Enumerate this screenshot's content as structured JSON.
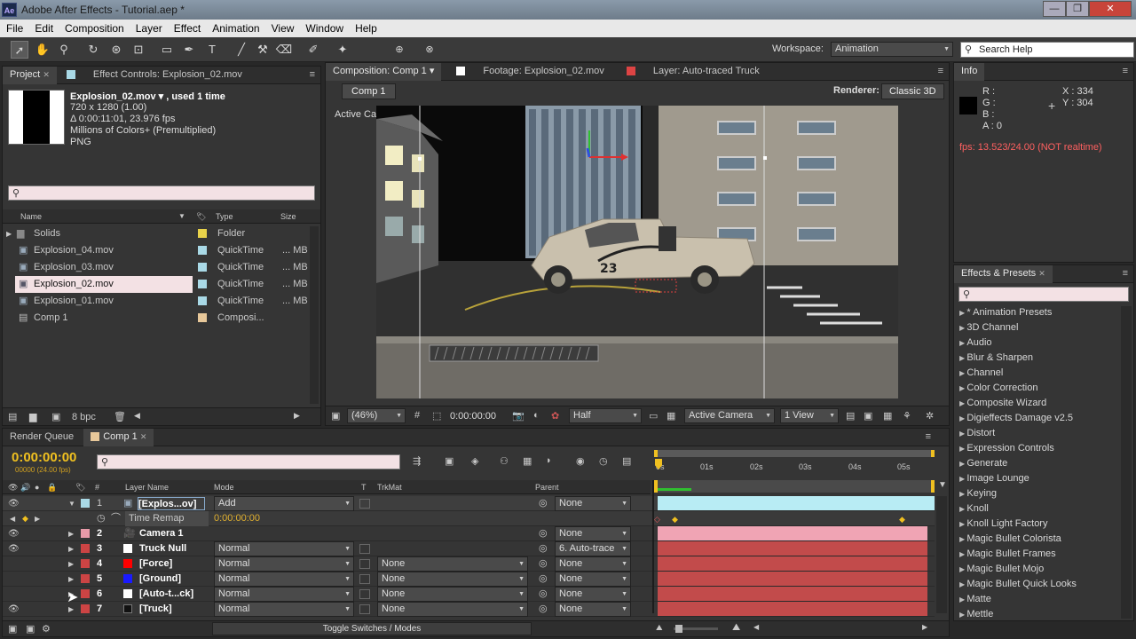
{
  "window": {
    "app_badge": "Ae",
    "title": "Adobe After Effects - Tutorial.aep *",
    "buttons": [
      "—",
      "❐",
      "✕"
    ]
  },
  "menu": [
    "File",
    "Edit",
    "Composition",
    "Layer",
    "Effect",
    "Animation",
    "View",
    "Window",
    "Help"
  ],
  "toolbar": {
    "workspace_label": "Workspace:",
    "workspace_value": "Animation",
    "search_placeholder": "Search Help"
  },
  "project": {
    "tab_project": "Project",
    "tab_effect_controls": "Effect Controls: Explosion_02.mov",
    "selected_name": "Explosion_02.mov ▾ , used 1 time",
    "info_lines": [
      "720 x 1280 (1.00)",
      "Δ 0:00:11:01, 23.976 fps",
      "Millions of Colors+ (Premultiplied)",
      "PNG"
    ],
    "search_value": "",
    "columns": {
      "name": "Name",
      "type": "Type",
      "size": "Size"
    },
    "items": [
      {
        "name": "Solids",
        "type": "Folder",
        "size": "",
        "color": "#e8d24a",
        "icon": "folder-icon"
      },
      {
        "name": "Explosion_04.mov",
        "type": "QuickTime",
        "size": "... MB",
        "color": "#a9d9e6",
        "icon": "footage-icon"
      },
      {
        "name": "Explosion_03.mov",
        "type": "QuickTime",
        "size": "... MB",
        "color": "#a9d9e6",
        "icon": "footage-icon"
      },
      {
        "name": "Explosion_02.mov",
        "type": "QuickTime",
        "size": "... MB",
        "color": "#a9d9e6",
        "icon": "footage-icon",
        "selected": true
      },
      {
        "name": "Explosion_01.mov",
        "type": "QuickTime",
        "size": "... MB",
        "color": "#a9d9e6",
        "icon": "footage-icon"
      },
      {
        "name": "Comp 1",
        "type": "Composi...",
        "size": "",
        "color": "#e8c89a",
        "icon": "composition-icon"
      }
    ],
    "bpc": "8 bpc"
  },
  "composition": {
    "tab_comp": "Composition: Comp 1",
    "tab_footage": "Footage: Explosion_02.mov",
    "tab_layer": "Layer: Auto-traced Truck",
    "breadcrumb": "Comp 1",
    "renderer_label": "Renderer:",
    "renderer_value": "Classic 3D",
    "view_label": "Active Camera",
    "truck_number": "23",
    "footer": {
      "zoom": "(46%)",
      "timecode": "0:00:00:00",
      "resolution": "Half",
      "camera": "Active Camera",
      "views": "1 View"
    }
  },
  "info": {
    "tab": "Info",
    "r": "R :",
    "g": "G :",
    "b": "B :",
    "a": "A : 0",
    "x": "X : 334",
    "y": "Y : 304",
    "fps": "fps: 13.523/24.00 (NOT realtime)"
  },
  "effects": {
    "tab": "Effects & Presets",
    "search_value": "",
    "items": [
      "* Animation Presets",
      "3D Channel",
      "Audio",
      "Blur & Sharpen",
      "Channel",
      "Color Correction",
      "Composite Wizard",
      "Digieffects Damage v2.5",
      "Distort",
      "Expression Controls",
      "Generate",
      "Image Lounge",
      "Keying",
      "Knoll",
      "Knoll Light Factory",
      "Magic Bullet Colorista",
      "Magic Bullet Frames",
      "Magic Bullet Mojo",
      "Magic Bullet Quick Looks",
      "Matte",
      "Mettle"
    ]
  },
  "timeline": {
    "tab_render": "Render Queue",
    "tab_comp": "Comp 1",
    "timecode": "0:00:00:00",
    "frames": "00000 (24.00 fps)",
    "search_value": "",
    "columns": {
      "num": "#",
      "name": "Layer Name",
      "mode": "Mode",
      "t": "T",
      "trkmat": "TrkMat",
      "parent": "Parent"
    },
    "ruler": [
      "0s",
      "01s",
      "02s",
      "03s",
      "04s",
      "05s"
    ],
    "toggle": "Toggle Switches / Modes",
    "sub_property": {
      "name": "Time Remap",
      "value": "0:00:00:00"
    },
    "layers": [
      {
        "num": "1",
        "name": "[Explos...ov]",
        "mode": "Add",
        "trkmat": "",
        "parent": "None",
        "label": "#a9d9e6",
        "swatch": "#ffffff",
        "bar": "#b8ecf4",
        "selected": true
      },
      {
        "num": "2",
        "name": "Camera 1",
        "mode": "",
        "trkmat": "",
        "parent": "None",
        "label": "#e89aa8",
        "swatch": "",
        "bar": "#f0a4b4"
      },
      {
        "num": "3",
        "name": "Truck Null",
        "mode": "Normal",
        "trkmat": "",
        "parent": "6. Auto-trace",
        "label": "#cc4444",
        "swatch": "#ffffff",
        "bar": "#c24b4b"
      },
      {
        "num": "4",
        "name": "[Force]",
        "mode": "Normal",
        "trkmat": "None",
        "parent": "None",
        "label": "#cc4444",
        "swatch": "#ff0000",
        "bar": "#c24b4b"
      },
      {
        "num": "5",
        "name": "[Ground]",
        "mode": "Normal",
        "trkmat": "None",
        "parent": "None",
        "label": "#cc4444",
        "swatch": "#1a1aff",
        "bar": "#c24b4b"
      },
      {
        "num": "6",
        "name": "[Auto-t...ck]",
        "mode": "Normal",
        "trkmat": "None",
        "parent": "None",
        "label": "#cc4444",
        "swatch": "#ffffff",
        "bar": "#c24b4b"
      },
      {
        "num": "7",
        "name": "[Truck]",
        "mode": "Normal",
        "trkmat": "None",
        "parent": "None",
        "label": "#cc4444",
        "swatch": "#111111",
        "bar": "#c24b4b"
      }
    ]
  }
}
